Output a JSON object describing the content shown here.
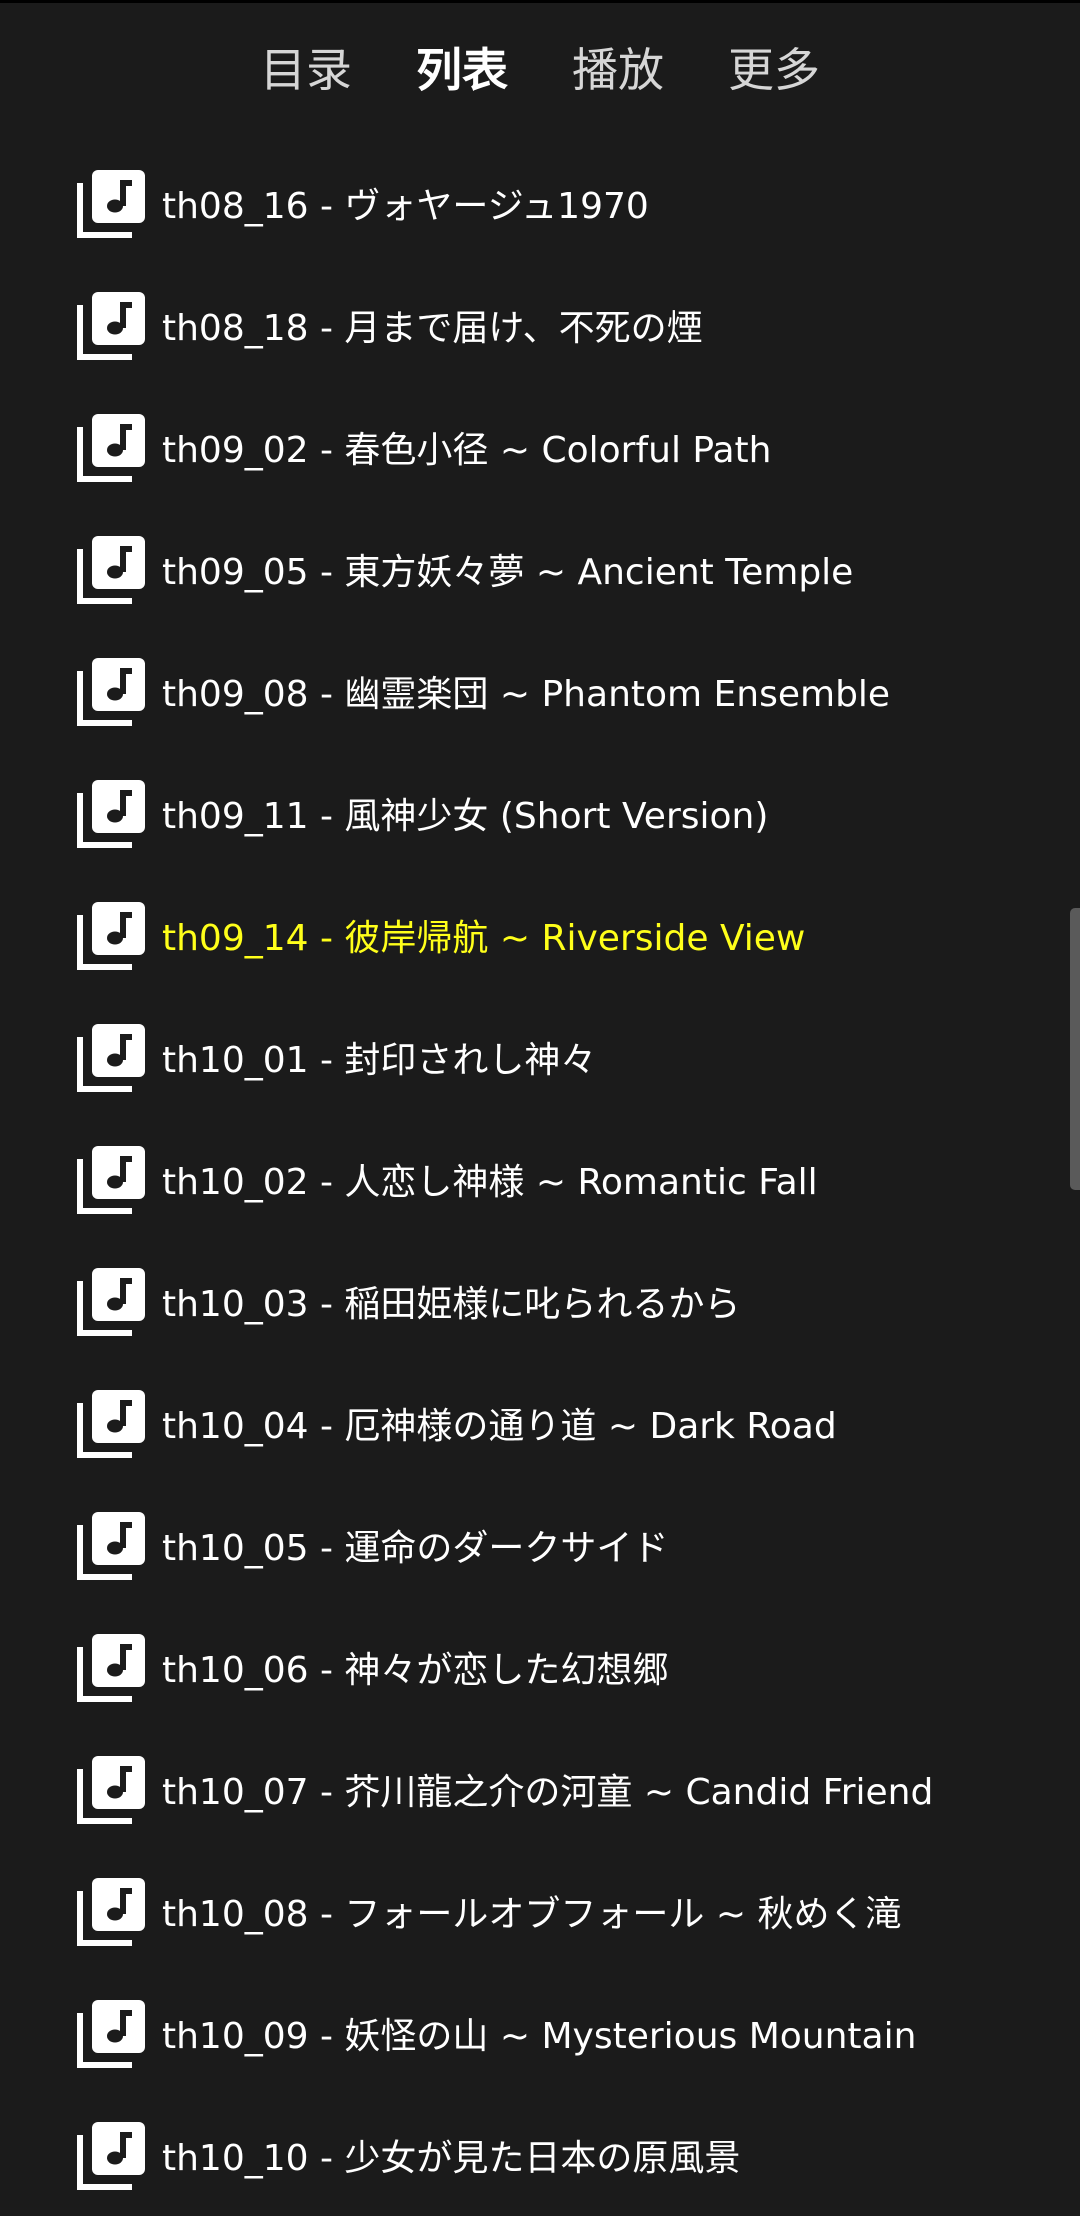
{
  "tabs": [
    {
      "label": "目录"
    },
    {
      "label": "列表",
      "active": true
    },
    {
      "label": "播放"
    },
    {
      "label": "更多"
    }
  ],
  "playlist": {
    "icon": "music-library-icon",
    "current_index": 6,
    "items": [
      {
        "label": "th08_16 - ヴォヤージュ1970"
      },
      {
        "label": "th08_18 - 月まで届け、不死の煙"
      },
      {
        "label": "th09_02 - 春色小径 ~ Colorful Path"
      },
      {
        "label": "th09_05 - 東方妖々夢 ~ Ancient Temple"
      },
      {
        "label": "th09_08 - 幽霊楽団 ~ Phantom Ensemble"
      },
      {
        "label": "th09_11 - 風神少女 (Short Version)"
      },
      {
        "label": "th09_14 - 彼岸帰航 ~ Riverside View"
      },
      {
        "label": "th10_01 - 封印されし神々"
      },
      {
        "label": "th10_02 - 人恋し神様 ~ Romantic Fall"
      },
      {
        "label": "th10_03 - 稲田姫様に叱られるから"
      },
      {
        "label": "th10_04 - 厄神様の通り道 ~ Dark Road"
      },
      {
        "label": "th10_05 - 運命のダークサイド"
      },
      {
        "label": "th10_06 - 神々が恋した幻想郷"
      },
      {
        "label": "th10_07 - 芥川龍之介の河童 ~ Candid Friend"
      },
      {
        "label": "th10_08 - フォールオブフォール ~ 秋めく滝"
      },
      {
        "label": "th10_09 - 妖怪の山 ~ Mysterious Mountain"
      },
      {
        "label": "th10_10 - 少女が見た日本の原風景"
      }
    ]
  },
  "colors": {
    "background": "#1b1b1b",
    "text": "#ffffff",
    "highlight": "#ffff1a"
  }
}
